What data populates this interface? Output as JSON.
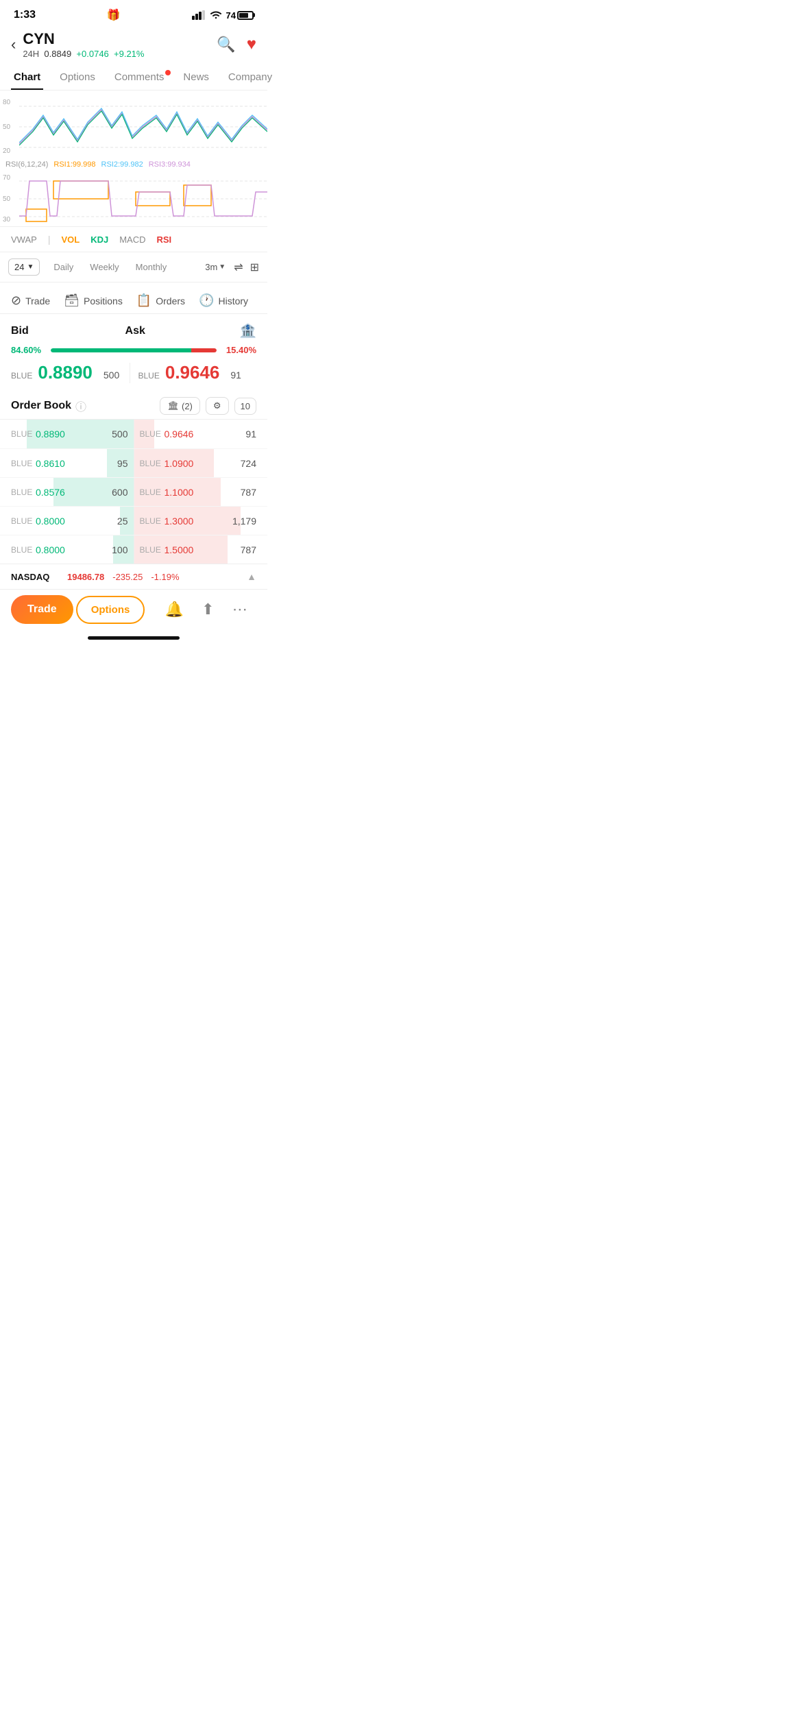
{
  "statusBar": {
    "time": "1:33",
    "gift_icon": "🎁"
  },
  "header": {
    "ticker": "CYN",
    "period": "24H",
    "price": "0.8849",
    "change": "+0.0746",
    "changePct": "+9.21%"
  },
  "navTabs": [
    {
      "label": "Chart",
      "active": true,
      "badge": false
    },
    {
      "label": "Options",
      "active": false,
      "badge": false
    },
    {
      "label": "Comments",
      "active": false,
      "badge": true
    },
    {
      "label": "News",
      "active": false,
      "badge": false
    },
    {
      "label": "Company",
      "active": false,
      "badge": false
    }
  ],
  "chart": {
    "rsi_label": "RSI(6,12,24)",
    "rsi1": "RSI1:99.998",
    "rsi2": "RSI2:99.982",
    "rsi3": "RSI3:99.934",
    "gridLabels": [
      "80",
      "50",
      "20"
    ],
    "rsiGridLabels": [
      "70",
      "50",
      "30"
    ]
  },
  "indicators": [
    {
      "label": "VWAP",
      "style": "normal"
    },
    {
      "label": "VOL",
      "style": "active-orange"
    },
    {
      "label": "KDJ",
      "style": "active-green"
    },
    {
      "label": "MACD",
      "style": "normal"
    },
    {
      "label": "RSI",
      "style": "active-red"
    }
  ],
  "timeframes": [
    {
      "label": "Daily",
      "active": false
    },
    {
      "label": "Weekly",
      "active": false
    },
    {
      "label": "Monthly",
      "active": false
    }
  ],
  "periodSelector": "24",
  "intervalBtn": "3m",
  "actionTabs": [
    {
      "label": "Trade",
      "icon": "⊘"
    },
    {
      "label": "Positions",
      "icon": "🗃"
    },
    {
      "label": "Orders",
      "icon": "📋"
    },
    {
      "label": "History",
      "icon": "🕐"
    }
  ],
  "bidAsk": {
    "bid_label": "Bid",
    "ask_label": "Ask",
    "bid_pct": "84.60%",
    "ask_pct": "15.40%",
    "bid_bar_width": 84.6,
    "ask_bar_width": 15.4,
    "bid_color": "BLUE",
    "bid_price": "0.8890",
    "bid_qty": "500",
    "ask_color": "BLUE",
    "ask_price": "0.9646",
    "ask_qty": "91"
  },
  "orderBook": {
    "title": "Order Book",
    "count": "(2)",
    "numDisplay": "10",
    "rows": [
      {
        "bid_color": "BLUE",
        "bid_price": "0.8890",
        "bid_qty": "500",
        "ask_color": "BLUE",
        "ask_price": "0.9646",
        "ask_qty": "91",
        "bid_bar": 80,
        "ask_bar": 15
      },
      {
        "bid_color": "BLUE",
        "bid_price": "0.8610",
        "bid_qty": "95",
        "ask_color": "BLUE",
        "ask_price": "1.0900",
        "ask_qty": "724",
        "bid_bar": 20,
        "ask_bar": 60
      },
      {
        "bid_color": "BLUE",
        "bid_price": "0.8576",
        "bid_qty": "600",
        "ask_color": "BLUE",
        "ask_price": "1.1000",
        "ask_qty": "787",
        "bid_bar": 60,
        "ask_bar": 65
      },
      {
        "bid_color": "BLUE",
        "bid_price": "0.8000",
        "bid_qty": "25",
        "ask_color": "BLUE",
        "ask_price": "1.3000",
        "ask_qty": "1,179",
        "bid_bar": 10,
        "ask_bar": 80
      },
      {
        "bid_color": "BLUE",
        "bid_price": "0.8000",
        "bid_qty": "100",
        "ask_color": "BLUE",
        "ask_price": "1.5000",
        "ask_qty": "787",
        "bid_bar": 15,
        "ask_bar": 70
      }
    ]
  },
  "ticker": {
    "name": "NASDAQ",
    "price": "19486.78",
    "change": "-235.25",
    "changePct": "-1.19%"
  },
  "bottomNav": {
    "trade": "Trade",
    "options": "Options"
  }
}
